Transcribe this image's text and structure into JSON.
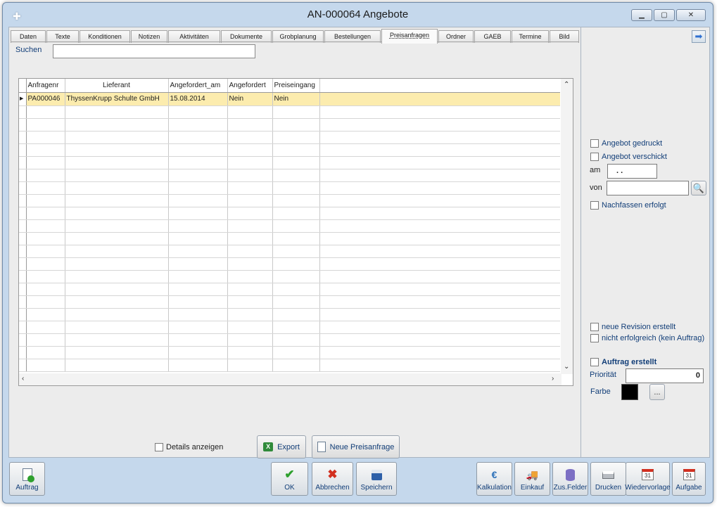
{
  "window": {
    "title": "AN-000064 Angebote"
  },
  "tabs": [
    {
      "label": "Daten",
      "active": false
    },
    {
      "label": "Texte",
      "active": false
    },
    {
      "label": "Konditionen",
      "active": false
    },
    {
      "label": "Notizen",
      "active": false
    },
    {
      "label": "Aktivitäten",
      "active": false
    },
    {
      "label": "Dokumente",
      "active": false
    },
    {
      "label": "Grobplanung",
      "active": false
    },
    {
      "label": "Bestellungen",
      "active": false
    },
    {
      "label": "Preisanfragen",
      "active": true
    },
    {
      "label": "Ordner",
      "active": false
    },
    {
      "label": "GAEB",
      "active": false
    },
    {
      "label": "Termine",
      "active": false
    },
    {
      "label": "Bild",
      "active": false
    }
  ],
  "search": {
    "label": "Suchen",
    "value": ""
  },
  "table": {
    "columns": [
      "Anfragenr",
      "Lieferant",
      "Angefordert_am",
      "Angefordert",
      "Preiseingang"
    ],
    "rows": [
      [
        "PA000046",
        "ThyssenKrupp Schulte GmbH",
        "15.08.2014",
        "Nein",
        "Nein"
      ]
    ],
    "selected_row_color": "#fcecae"
  },
  "footer_controls": {
    "details_label": "Details anzeigen",
    "export_label": "Export",
    "new_request_label": "Neue Preisanfrage"
  },
  "sidebar": {
    "angebot_gedruckt": "Angebot gedruckt",
    "angebot_verschickt": "Angebot verschickt",
    "am_label": "am",
    "am_value": ". .",
    "von_label": "von",
    "von_value": "",
    "nachfassen": "Nachfassen erfolgt",
    "neue_revision": "neue Revision erstellt",
    "nicht_erfolgreich": "nicht erfolgreich (kein Auftrag)",
    "auftrag_erstellt": "Auftrag erstellt",
    "prioritaet_label": "Priorität",
    "prioritaet_value": "0",
    "farbe_label": "Farbe",
    "farbe_value": "#000000",
    "farbe_button": "..."
  },
  "toolbar": {
    "auftrag": "Auftrag",
    "ok": "OK",
    "abbrechen": "Abbrechen",
    "speichern": "Speichern",
    "kalkulation": "Kalkulation",
    "einkauf": "Einkauf",
    "zus_felder": "Zus.Felder",
    "drucken": "Drucken",
    "wiedervorlage": "Wiedervorlage",
    "aufgabe": "Aufgabe",
    "calendar_day": "31"
  },
  "colors": {
    "window_frame": "#c5d8ec",
    "label_blue": "#123e78",
    "ok_green": "#2ea02e",
    "cancel_red": "#d23020",
    "nav_arrow_blue": "#2f6fd0"
  }
}
